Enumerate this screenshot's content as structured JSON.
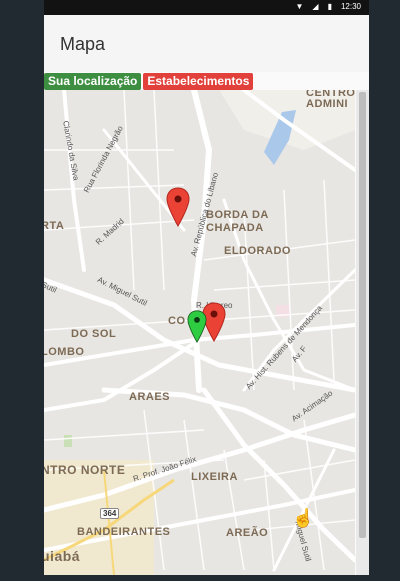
{
  "status_bar": {
    "time": "12:30",
    "icons": [
      "wifi-icon",
      "signal-icon",
      "battery-icon"
    ]
  },
  "app_bar": {
    "title": "Mapa"
  },
  "legend": {
    "your_location": "Sua localização",
    "establishments": "Estabelecimentos",
    "colors": {
      "your_location": "#3e8e41",
      "establishments": "#e2403a"
    }
  },
  "map": {
    "areas": [
      "BORDA DA",
      "CHAPADA",
      "ELDORADO",
      "ARAES",
      "LIXEIRA",
      "BANDEIRANTES",
      "AREÃO",
      "NTRO NORTE",
      "CENTRO",
      "ADMINI",
      "DO SOL",
      "LOMBO",
      "RTA",
      "uiabá",
      "CO"
    ],
    "streets": [
      "Clarindo da Silva",
      "Rua Florinda Negrão",
      "R. Madrid",
      "Av. República do Líbano",
      "Av. Miguel Sutil",
      "Av. Hist. Rubens de Mendonça",
      "Av. Acimação",
      "R. Prof. João Félix",
      "Sutil",
      "R. Ubereo",
      "Av. F",
      "Miguel Sutil"
    ],
    "road_badge": "364",
    "markers": [
      {
        "type": "establishment",
        "icon": "map-pin-red-icon"
      },
      {
        "type": "establishment",
        "icon": "map-pin-red-icon"
      },
      {
        "type": "user",
        "icon": "map-pin-green-icon"
      }
    ],
    "cursor_icon": "hand-cursor-icon"
  }
}
